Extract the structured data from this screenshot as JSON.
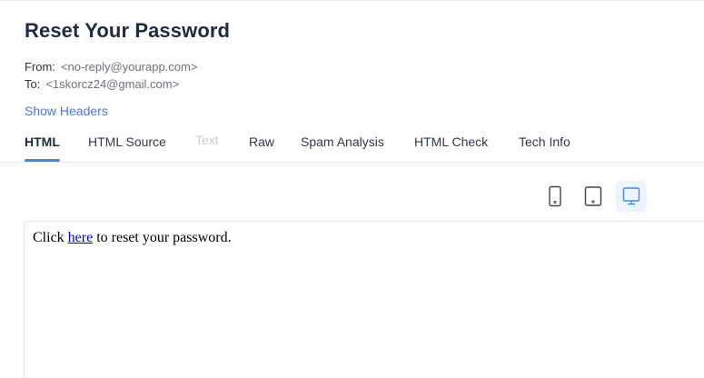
{
  "email": {
    "subject": "Reset Your Password",
    "from_label": "From:",
    "from_value": "<no-reply@yourapp.com>",
    "to_label": "To:",
    "to_value": "<1skorcz24@gmail.com>",
    "show_headers_label": "Show Headers"
  },
  "tabs": [
    {
      "label": "HTML",
      "state": "active"
    },
    {
      "label": "HTML Source",
      "state": "normal"
    },
    {
      "label": "Text",
      "state": "disabled"
    },
    {
      "label": "Raw",
      "state": "normal"
    },
    {
      "label": "Spam Analysis",
      "state": "normal"
    },
    {
      "label": "HTML Check",
      "state": "normal"
    },
    {
      "label": "Tech Info",
      "state": "normal"
    }
  ],
  "device_toggles": [
    {
      "icon": "mobile-icon",
      "active": false
    },
    {
      "icon": "tablet-icon",
      "active": false
    },
    {
      "icon": "desktop-icon",
      "active": true
    }
  ],
  "preview": {
    "text_before": "Click ",
    "link_text": "here",
    "text_after": " to reset your password."
  },
  "colors": {
    "accent": "#4a86e0",
    "link": "#0000ee",
    "disabled_tab": "#c9cdd3"
  }
}
